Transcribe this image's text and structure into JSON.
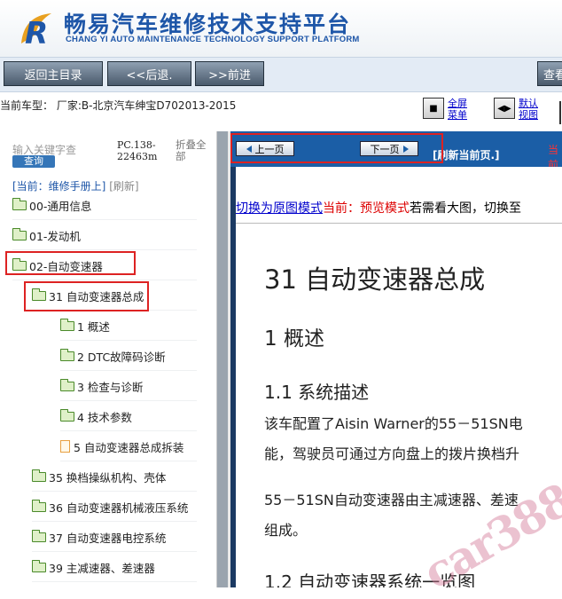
{
  "header": {
    "title": "畅易汽车维修技术支持平台",
    "subtitle": "CHANG YI AUTO MAINTENANCE TECHNOLOGY SUPPORT PLATFORM"
  },
  "navbar": {
    "home": "返回主目录",
    "back": "<<后退.",
    "forward": ">>前进",
    "search": "查看"
  },
  "vehicle": {
    "info": "当前车型：  厂家:B-北京汽车绅宝D702013-2015"
  },
  "toolbar": {
    "fullscreen": "全屏\n菜单",
    "default": "默认\n视图"
  },
  "left": {
    "search_placeholder": "输入关键字查",
    "search_button": "查询",
    "pc_number": "PC.138-\n22463m",
    "collapse": "折叠全部",
    "crumb_current": "[当前：维修手册上]",
    "crumb_refresh": "[刷新]",
    "tree": [
      {
        "label": "00-通用信息",
        "kind": "folder"
      },
      {
        "label": "01-发动机",
        "kind": "folder"
      },
      {
        "label": "02-自动变速器",
        "kind": "folder"
      },
      {
        "label": "31 自动变速器总成",
        "kind": "folder"
      },
      {
        "label": "1 概述",
        "kind": "folder"
      },
      {
        "label": "2 DTC故障码诊断",
        "kind": "folder"
      },
      {
        "label": "3 检查与诊断",
        "kind": "folder"
      },
      {
        "label": "4 技术参数",
        "kind": "folder"
      },
      {
        "label": "5 自动变速器总成拆装",
        "kind": "doc"
      },
      {
        "label": "35 换档操纵机构、壳体",
        "kind": "folder"
      },
      {
        "label": "36 自动变速器机械液压系统",
        "kind": "folder"
      },
      {
        "label": "37 自动变速器电控系统",
        "kind": "folder"
      },
      {
        "label": "39 主减速器、差速器",
        "kind": "folder"
      }
    ]
  },
  "pager": {
    "prev": "上一页",
    "next": "下一页",
    "refresh": "[刷新当前页.]",
    "current": "当前"
  },
  "content": {
    "switch_link": "切换为原图模式",
    "current_mode": "当前：预览模式",
    "hint": "若需看大图，切换至",
    "h1": "31 自动变速器总成",
    "h2": "1 概述",
    "h3": "1.1 系统描述",
    "p1_line1": "该车配置了Aisin Warner的55－51SN电",
    "p1_line2": "能，驾驶员可通过方向盘上的拨片换档升",
    "p2_line1": "55－51SN自动变速器由主减速器、差速",
    "p2_line2": "组成。",
    "h3b": "1.2 自动变速器系统一览图"
  },
  "watermark": "car388"
}
